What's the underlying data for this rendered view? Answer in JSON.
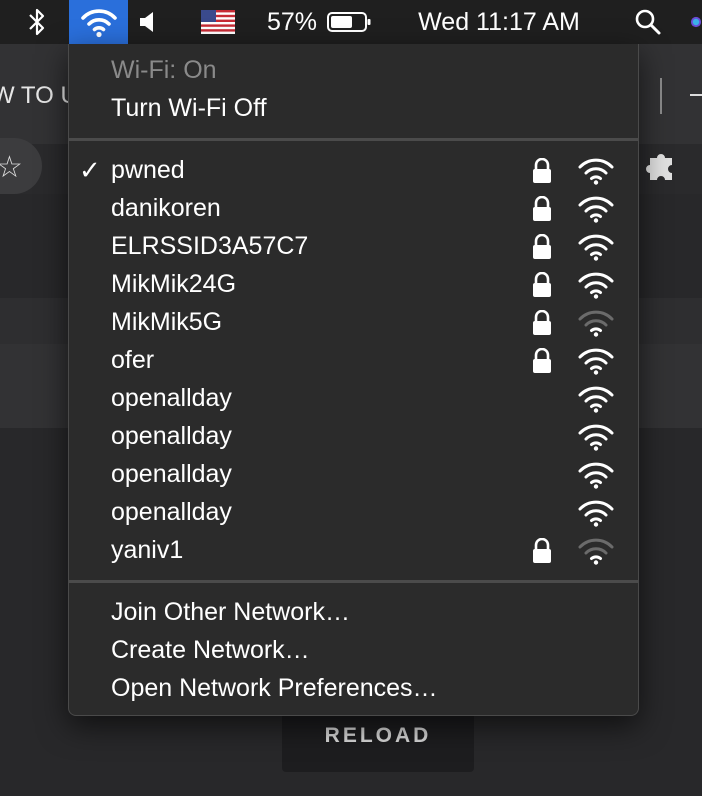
{
  "menubar": {
    "battery_percent": "57%",
    "clock": "Wed 11:17 AM"
  },
  "background": {
    "tab_text": "W TO U",
    "reload_label": "RELOAD"
  },
  "wifi_menu": {
    "status": "Wi-Fi: On",
    "toggle_label": "Turn Wi-Fi Off",
    "networks": [
      {
        "name": "pwned",
        "selected": true,
        "locked": true,
        "signal": "full"
      },
      {
        "name": "danikoren",
        "selected": false,
        "locked": true,
        "signal": "full"
      },
      {
        "name": "ELRSSID3A57C7",
        "selected": false,
        "locked": true,
        "signal": "full"
      },
      {
        "name": "MikMik24G",
        "selected": false,
        "locked": true,
        "signal": "full"
      },
      {
        "name": "MikMik5G",
        "selected": false,
        "locked": true,
        "signal": "weak"
      },
      {
        "name": "ofer",
        "selected": false,
        "locked": true,
        "signal": "full"
      },
      {
        "name": "openallday",
        "selected": false,
        "locked": false,
        "signal": "full"
      },
      {
        "name": "openallday",
        "selected": false,
        "locked": false,
        "signal": "full"
      },
      {
        "name": "openallday",
        "selected": false,
        "locked": false,
        "signal": "full"
      },
      {
        "name": "openallday",
        "selected": false,
        "locked": false,
        "signal": "full"
      },
      {
        "name": "yaniv1",
        "selected": false,
        "locked": true,
        "signal": "weak"
      }
    ],
    "join_other": "Join Other Network…",
    "create_network": "Create Network…",
    "open_prefs": "Open Network Preferences…"
  },
  "colors": {
    "menubar_bg": "#1f1f1f",
    "wifi_highlight": "#2a6fdb",
    "menu_bg": "#2b2b2b"
  },
  "icons": [
    "bluetooth-icon",
    "wifi-icon",
    "volume-icon",
    "us-flag-icon",
    "battery-icon",
    "spotlight-search-icon",
    "siri-icon",
    "checkmark-icon",
    "lock-icon",
    "wifi-signal-icon",
    "star-icon",
    "puzzle-icon"
  ]
}
